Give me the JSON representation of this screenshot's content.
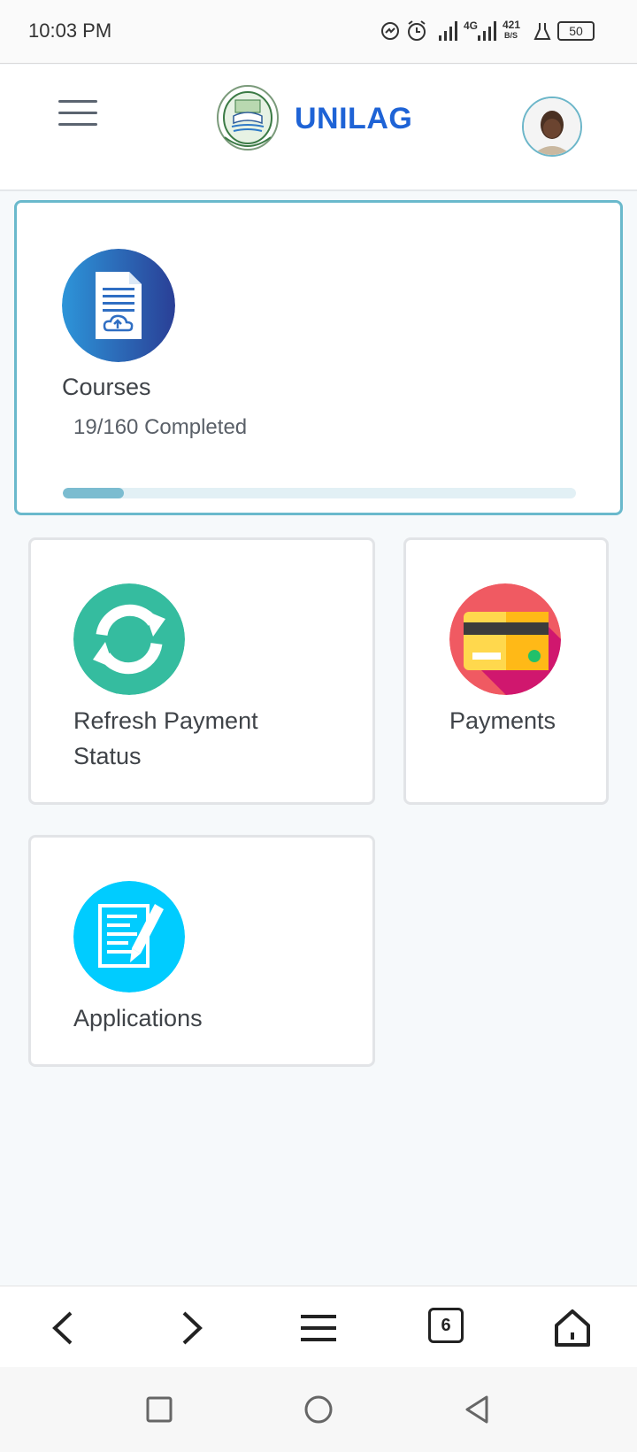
{
  "status_bar": {
    "time": "10:03 PM",
    "network_type": "4G",
    "speed_value": "421",
    "speed_unit": "B/S",
    "battery": "50"
  },
  "header": {
    "brand": "UNILAG"
  },
  "courses_card": {
    "title": "Courses",
    "progress_text": "19/160 Completed",
    "completed": 19,
    "total": 160
  },
  "tiles": {
    "refresh": {
      "title_line1": "Refresh Payment",
      "title_line2": "Status"
    },
    "payments": {
      "title": "Payments"
    },
    "applications": {
      "title": "Applications"
    }
  },
  "browser_bar": {
    "tab_count": "6"
  },
  "colors": {
    "brand_blue": "#1e63d6",
    "accent_teal": "#6ab9cc",
    "refresh_green": "#35bc9f",
    "applications_cyan": "#00ccff"
  },
  "icons": [
    "messenger-icon",
    "alarm-icon",
    "signal-icon",
    "battery-icon",
    "menu-icon",
    "logo-crest",
    "avatar",
    "document-upload-icon",
    "refresh-icon",
    "credit-card-icon",
    "edit-document-icon",
    "back-icon",
    "forward-icon",
    "browser-menu-icon",
    "tabs-icon",
    "home-icon",
    "recents-icon",
    "home-circle-icon",
    "back-triangle-icon"
  ]
}
